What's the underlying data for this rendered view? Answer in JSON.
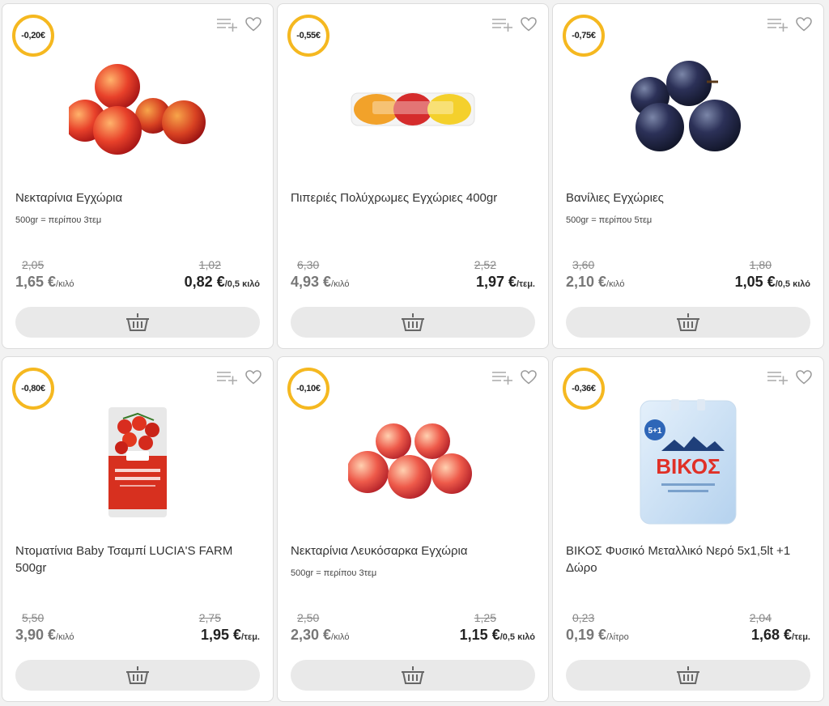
{
  "colors": {
    "badge_ring": "#f5b820",
    "card_border": "#dcdcdc",
    "button_bg": "#e9e9e9"
  },
  "products": [
    {
      "discount": "-0,20€",
      "name": "Νεκταρίνια Εγχώρια",
      "sub": "500gr = περίπου 3τεμ",
      "old_unit_price": "2,05",
      "unit_price": "1,65 €",
      "unit_label": "/κιλό",
      "old_price": "1,02",
      "price": "0,82 €",
      "price_label": "/0,5 κιλό",
      "image_icon": "nectarines-image"
    },
    {
      "discount": "-0,55€",
      "name": "Πιπεριές Πολύχρωμες Εγχώριες 400gr",
      "sub": "",
      "old_unit_price": "6,30",
      "unit_price": "4,93 €",
      "unit_label": "/κιλό",
      "old_price": "2,52",
      "price": "1,97 €",
      "price_label": "/τεμ.",
      "image_icon": "peppers-image"
    },
    {
      "discount": "-0,75€",
      "name": "Βανίλιες Εγχώριες",
      "sub": "500gr = περίπου 5τεμ",
      "old_unit_price": "3,60",
      "unit_price": "2,10 €",
      "unit_label": "/κιλό",
      "old_price": "1,80",
      "price": "1,05 €",
      "price_label": "/0,5 κιλό",
      "image_icon": "plums-image"
    },
    {
      "discount": "-0,80€",
      "name": "Ντοματίνια Baby Τσαμπί LUCIA'S FARM 500gr",
      "sub": "",
      "old_unit_price": "5,50",
      "unit_price": "3,90 €",
      "unit_label": "/κιλό",
      "old_price": "2,75",
      "price": "1,95 €",
      "price_label": "/τεμ.",
      "image_icon": "cherry-tomatoes-pack-image"
    },
    {
      "discount": "-0,10€",
      "name": "Νεκταρίνια Λευκόσαρκα Εγχώρια",
      "sub": "500gr = περίπου 3τεμ",
      "old_unit_price": "2,50",
      "unit_price": "2,30 €",
      "unit_label": "/κιλό",
      "old_price": "1,25",
      "price": "1,15 €",
      "price_label": "/0,5 κιλό",
      "image_icon": "white-nectarines-image"
    },
    {
      "discount": "-0,36€",
      "name": "ΒΙΚΟΣ Φυσικό Μεταλλικό Νερό 5x1,5lt +1 Δώρο",
      "sub": "",
      "old_unit_price": "0,23",
      "unit_price": "0,19 €",
      "unit_label": "/λίτρο",
      "old_price": "2,04",
      "price": "1,68 €",
      "price_label": "/τεμ.",
      "image_icon": "water-pack-image",
      "pack_brand": "ΒΙΚΟΣ",
      "pack_badge": "5+1"
    }
  ]
}
